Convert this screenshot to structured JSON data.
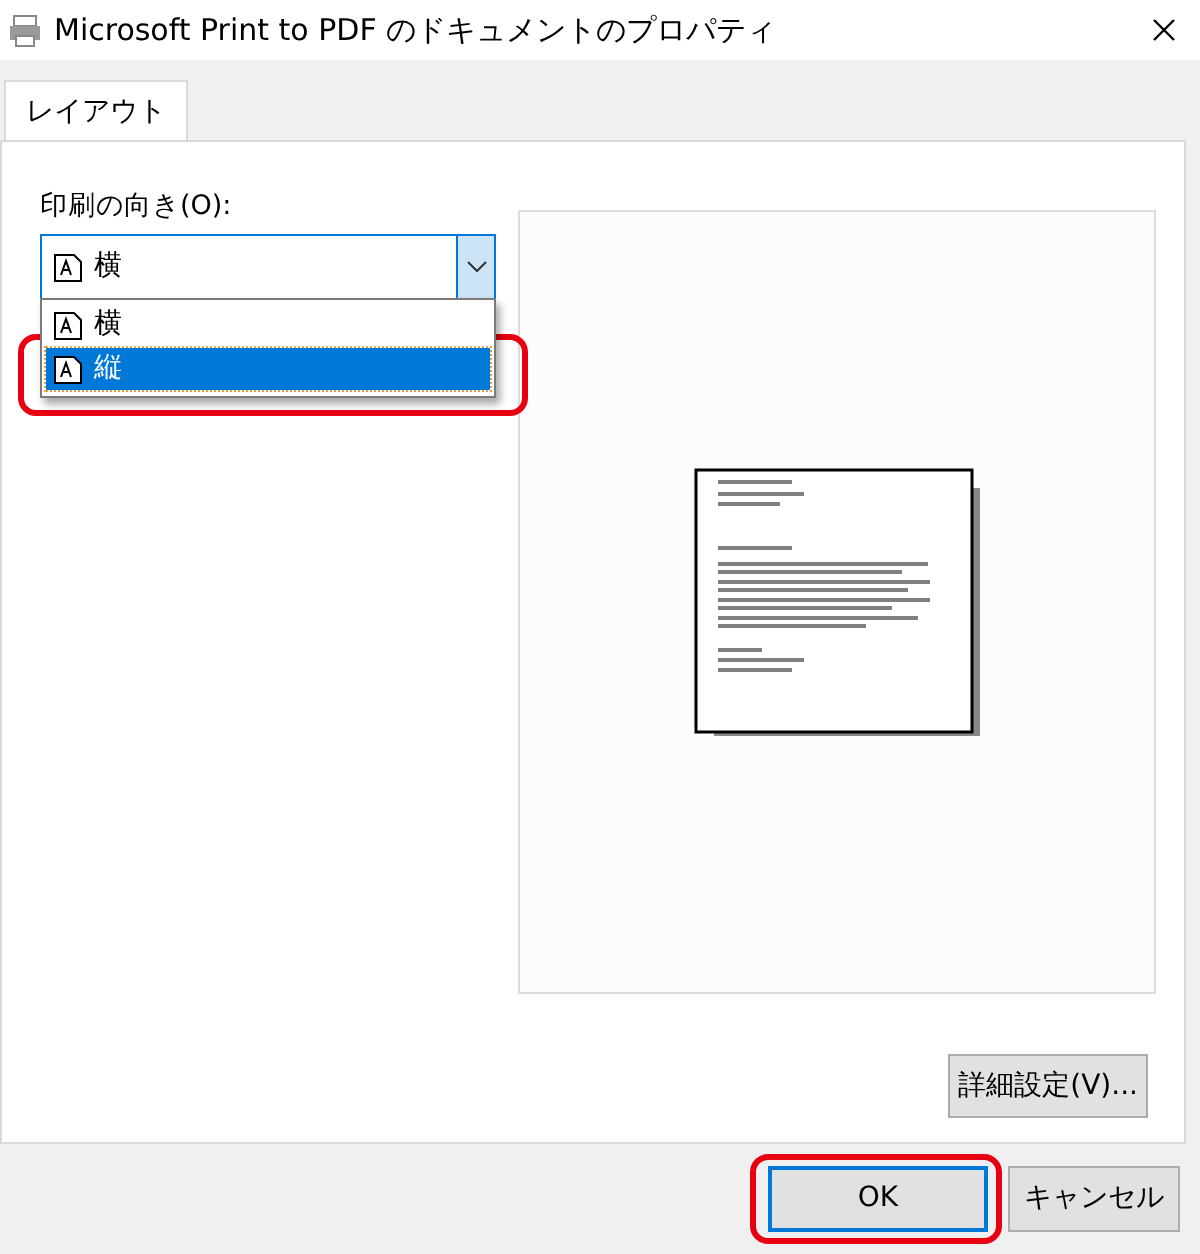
{
  "window": {
    "title": "Microsoft Print to PDF のドキュメントのプロパティ"
  },
  "tabs": [
    {
      "label": "レイアウト",
      "selected": true
    }
  ],
  "orientation": {
    "label": "印刷の向き(O):",
    "value": "横",
    "expanded": true,
    "options": [
      {
        "label": "横",
        "hovered": false,
        "annotated": false
      },
      {
        "label": "縦",
        "hovered": true,
        "annotated": true
      }
    ]
  },
  "advanced_button": "詳細設定(V)...",
  "buttons": [
    {
      "label": "OK",
      "default": true,
      "annotated": true
    },
    {
      "label": "キャンセル",
      "default": false,
      "annotated": false
    }
  ]
}
